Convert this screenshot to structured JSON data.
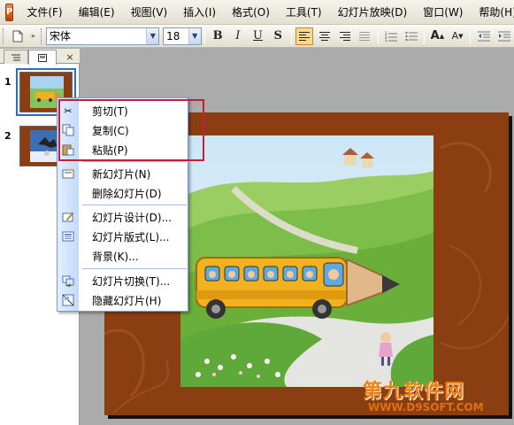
{
  "app": {
    "icon": "powerpoint-app-icon"
  },
  "menubar": {
    "items": [
      "文件(F)",
      "编辑(E)",
      "视图(V)",
      "插入(I)",
      "格式(O)",
      "工具(T)",
      "幻灯片放映(D)",
      "窗口(W)",
      "帮助(H)"
    ]
  },
  "toolbar": {
    "font_name": "宋体",
    "font_size": "18",
    "bold": "B",
    "italic": "I",
    "underline": "U",
    "shadow": "S",
    "grow_font": "A",
    "shrink_font": "A"
  },
  "left_panel": {
    "tab_close": "×",
    "slides": [
      "1",
      "2"
    ]
  },
  "context_menu": {
    "items": [
      {
        "label": "剪切(T)",
        "icon": "scissors-icon"
      },
      {
        "label": "复制(C)",
        "icon": "copy-icon"
      },
      {
        "label": "粘贴(P)",
        "icon": "paste-icon"
      },
      {
        "label": "新幻灯片(N)",
        "icon": "new-slide-icon"
      },
      {
        "label": "删除幻灯片(D)",
        "icon": ""
      },
      {
        "label": "幻灯片设计(D)...",
        "icon": "slide-design-icon"
      },
      {
        "label": "幻灯片版式(L)...",
        "icon": "slide-layout-icon"
      },
      {
        "label": "背景(K)...",
        "icon": ""
      },
      {
        "label": "幻灯片切换(T)...",
        "icon": "slide-transition-icon"
      },
      {
        "label": "隐藏幻灯片(H)",
        "icon": "hide-slide-icon"
      }
    ]
  },
  "watermark": {
    "title": "第九软件网",
    "url": "WWW.D9SOFT.COM"
  },
  "colors": {
    "highlight_box": "#C0203A",
    "slide_bg": "#8A3E12",
    "menu_gutter": "#C3DAF9"
  }
}
